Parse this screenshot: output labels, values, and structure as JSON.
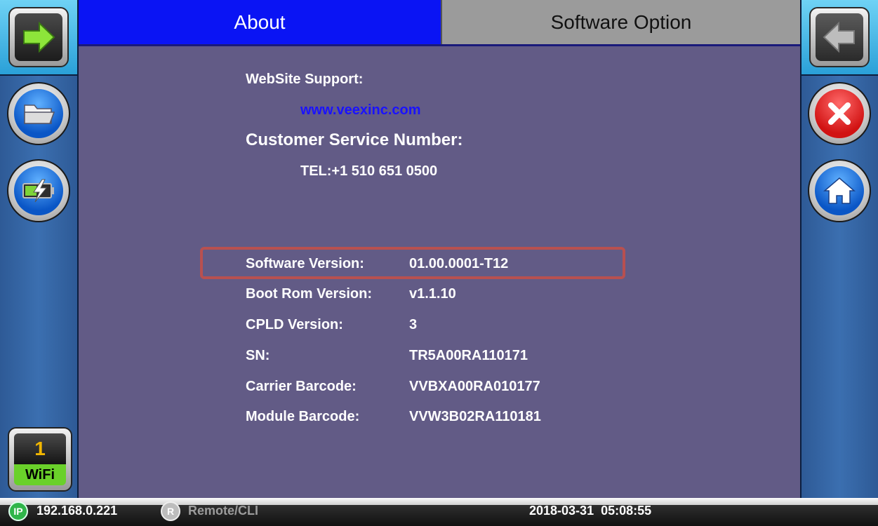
{
  "tabs": [
    {
      "label": "About",
      "active": true
    },
    {
      "label": "Software Option",
      "active": false
    }
  ],
  "about": {
    "website_label": "WebSite Support:",
    "website_url": "www.veexinc.com",
    "service_label": "Customer Service Number:",
    "service_tel": "TEL:+1 510 651 0500",
    "rows": [
      {
        "label": "Software Version:",
        "value": "01.00.0001-T12"
      },
      {
        "label": "Boot Rom Version:",
        "value": "v1.1.10"
      },
      {
        "label": "CPLD Version:",
        "value": "3"
      },
      {
        "label": "SN:",
        "value": "TR5A00RA110171"
      },
      {
        "label": "Carrier Barcode:",
        "value": "VVBXA00RA010177"
      },
      {
        "label": "Module Barcode:",
        "value": "VVW3B02RA110181"
      }
    ]
  },
  "left_panel": {
    "icons": [
      "next-arrow-icon",
      "folder-icon",
      "battery-charge-icon"
    ],
    "wifi": {
      "count": "1",
      "label": "WiFi"
    }
  },
  "right_panel": {
    "icons": [
      "back-arrow-icon",
      "close-icon",
      "home-icon"
    ]
  },
  "status_bar": {
    "ip_badge": "IP",
    "ip_address": "192.168.0.221",
    "remote_badge": "R",
    "remote_label": "Remote/CLI",
    "datetime": "2018-03-31  05:08:55"
  },
  "colors": {
    "active_tab": "#0a14f4",
    "inactive_tab": "#9b9b9b",
    "content_bg": "#625b86",
    "link": "#1a12ff",
    "highlight_border": "#b85050",
    "wifi_green": "#6ad12a"
  }
}
